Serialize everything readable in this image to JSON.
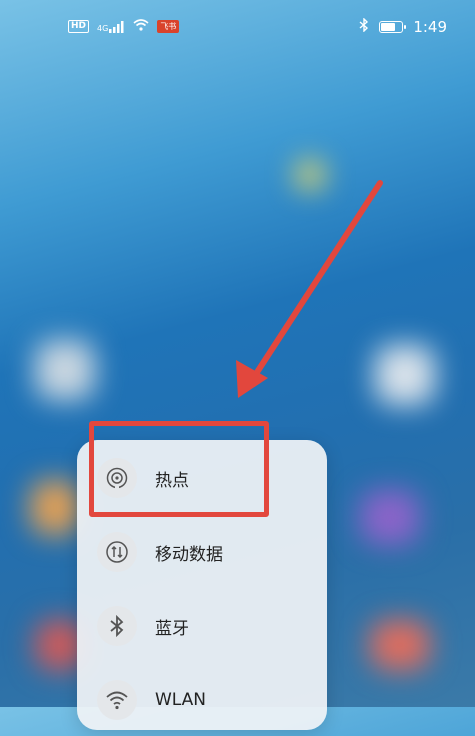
{
  "status_bar": {
    "hd_label": "HD",
    "network_label": "4G",
    "app_badge": "飞书",
    "time": "1:49",
    "battery_level": 0.6,
    "icons": [
      "signal-icon",
      "wifi-icon",
      "bluetooth-icon",
      "battery-icon"
    ]
  },
  "menu": {
    "items": [
      {
        "label": "热点",
        "icon": "hotspot-icon"
      },
      {
        "label": "移动数据",
        "icon": "mobile-data-icon"
      },
      {
        "label": "蓝牙",
        "icon": "bluetooth-icon"
      },
      {
        "label": "WLAN",
        "icon": "wifi-icon"
      }
    ]
  },
  "annotation": {
    "color": "#e2473d"
  }
}
